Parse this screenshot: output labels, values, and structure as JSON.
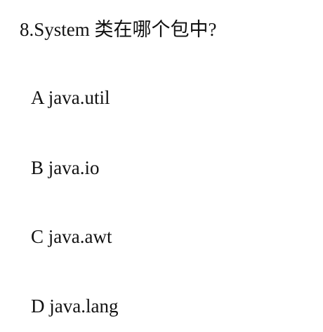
{
  "question": {
    "text": "8.System 类在哪个包中?"
  },
  "options": [
    {
      "text": "A java.util"
    },
    {
      "text": "B java.io"
    },
    {
      "text": "C java.awt"
    },
    {
      "text": "D java.lang"
    }
  ]
}
